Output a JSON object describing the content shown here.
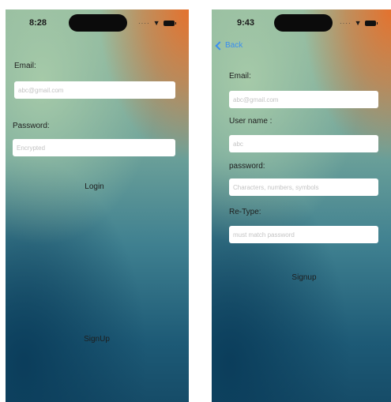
{
  "login_screen": {
    "status_time": "8:28",
    "email_label": "Email:",
    "email_placeholder": "abc@gmail.com",
    "password_label": "Password:",
    "password_placeholder": "Encrypted",
    "login_label": "Login",
    "signup_label": "SignUp"
  },
  "signup_screen": {
    "status_time": "9:43",
    "back_label": "Back",
    "email_label": "Email:",
    "email_placeholder": "abc@gmail.com",
    "username_label": "User name :",
    "username_placeholder": "abc",
    "password_label": "password:",
    "password_placeholder": "Characters, numbers, symbols",
    "retype_label": "Re-Type:",
    "retype_placeholder": "must match password",
    "signup_label": "Signup"
  },
  "colors": {
    "accent": "#3a8ef0",
    "text": "#1e1e1e",
    "field_bg": "#ffffff"
  }
}
